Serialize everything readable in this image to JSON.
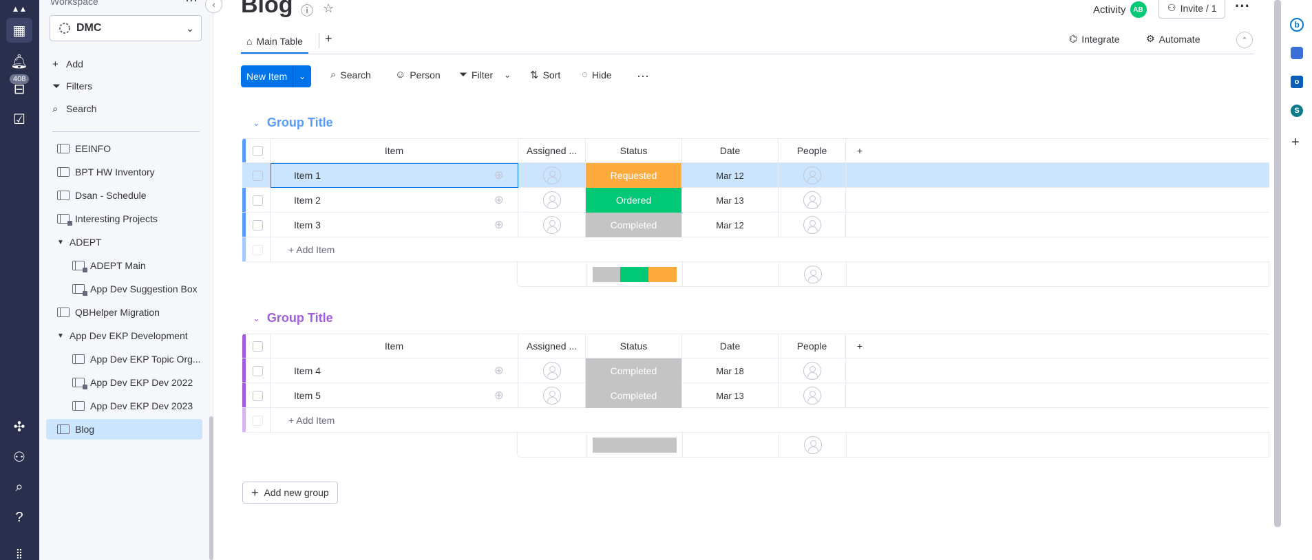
{
  "rail": {
    "notifications_badge": "408"
  },
  "sidebar": {
    "workspace_label": "Workspace",
    "workspace_name": "DMC",
    "actions": [
      {
        "label": "Add",
        "icon": "plus-icon"
      },
      {
        "label": "Filters",
        "icon": "filter-icon"
      },
      {
        "label": "Search",
        "icon": "search-icon"
      }
    ],
    "items": [
      {
        "label": "EEINFO",
        "type": "board"
      },
      {
        "label": "BPT HW Inventory",
        "type": "board"
      },
      {
        "label": "Dsan - Schedule",
        "type": "board"
      },
      {
        "label": "Interesting Projects",
        "type": "private-board"
      },
      {
        "label": "ADEPT",
        "type": "folder"
      },
      {
        "label": "ADEPT Main",
        "type": "private-board"
      },
      {
        "label": "App Dev Suggestion Box",
        "type": "private-board"
      },
      {
        "label": "QBHelper Migration",
        "type": "board"
      },
      {
        "label": "App Dev EKP Development",
        "type": "folder"
      },
      {
        "label": "App Dev EKP Topic Org...",
        "type": "board"
      },
      {
        "label": "App Dev EKP Dev 2022",
        "type": "private-board"
      },
      {
        "label": "App Dev EKP Dev 2023",
        "type": "board"
      },
      {
        "label": "Blog",
        "type": "board",
        "active": true
      }
    ]
  },
  "header": {
    "title": "Blog",
    "activity_label": "Activity",
    "activity_avatar": "AB",
    "invite_label": "Invite / 1",
    "tab_main": "Main Table",
    "tab_add": "+",
    "integrate": "Integrate",
    "automate": "Automate"
  },
  "toolbar": {
    "new_item": "New Item",
    "search": "Search",
    "person": "Person",
    "filter": "Filter",
    "sort": "Sort",
    "hide": "Hide"
  },
  "colors": {
    "accent": "#0073ea",
    "group1": "#579bfc",
    "group2": "#a25ddc",
    "requested": "#fdab3d",
    "ordered": "#00c875",
    "completed": "#c4c4c4"
  },
  "columns": {
    "item": "Item",
    "assigned": "Assigned ...",
    "status": "Status",
    "date": "Date",
    "people": "People"
  },
  "groups": [
    {
      "title": "Group Title",
      "rows": [
        {
          "name": "Item 1",
          "status": "Requested",
          "date": "Mar 12",
          "selected": true
        },
        {
          "name": "Item 2",
          "status": "Ordered",
          "date": "Mar 13"
        },
        {
          "name": "Item 3",
          "status": "Completed",
          "date": "Mar 12"
        }
      ],
      "add_item": "+ Add Item"
    },
    {
      "title": "Group Title",
      "rows": [
        {
          "name": "Item 4",
          "status": "Completed",
          "date": "Mar 18"
        },
        {
          "name": "Item 5",
          "status": "Completed",
          "date": "Mar 13"
        }
      ],
      "add_item": "+ Add Item"
    }
  ],
  "add_group": "Add new group"
}
